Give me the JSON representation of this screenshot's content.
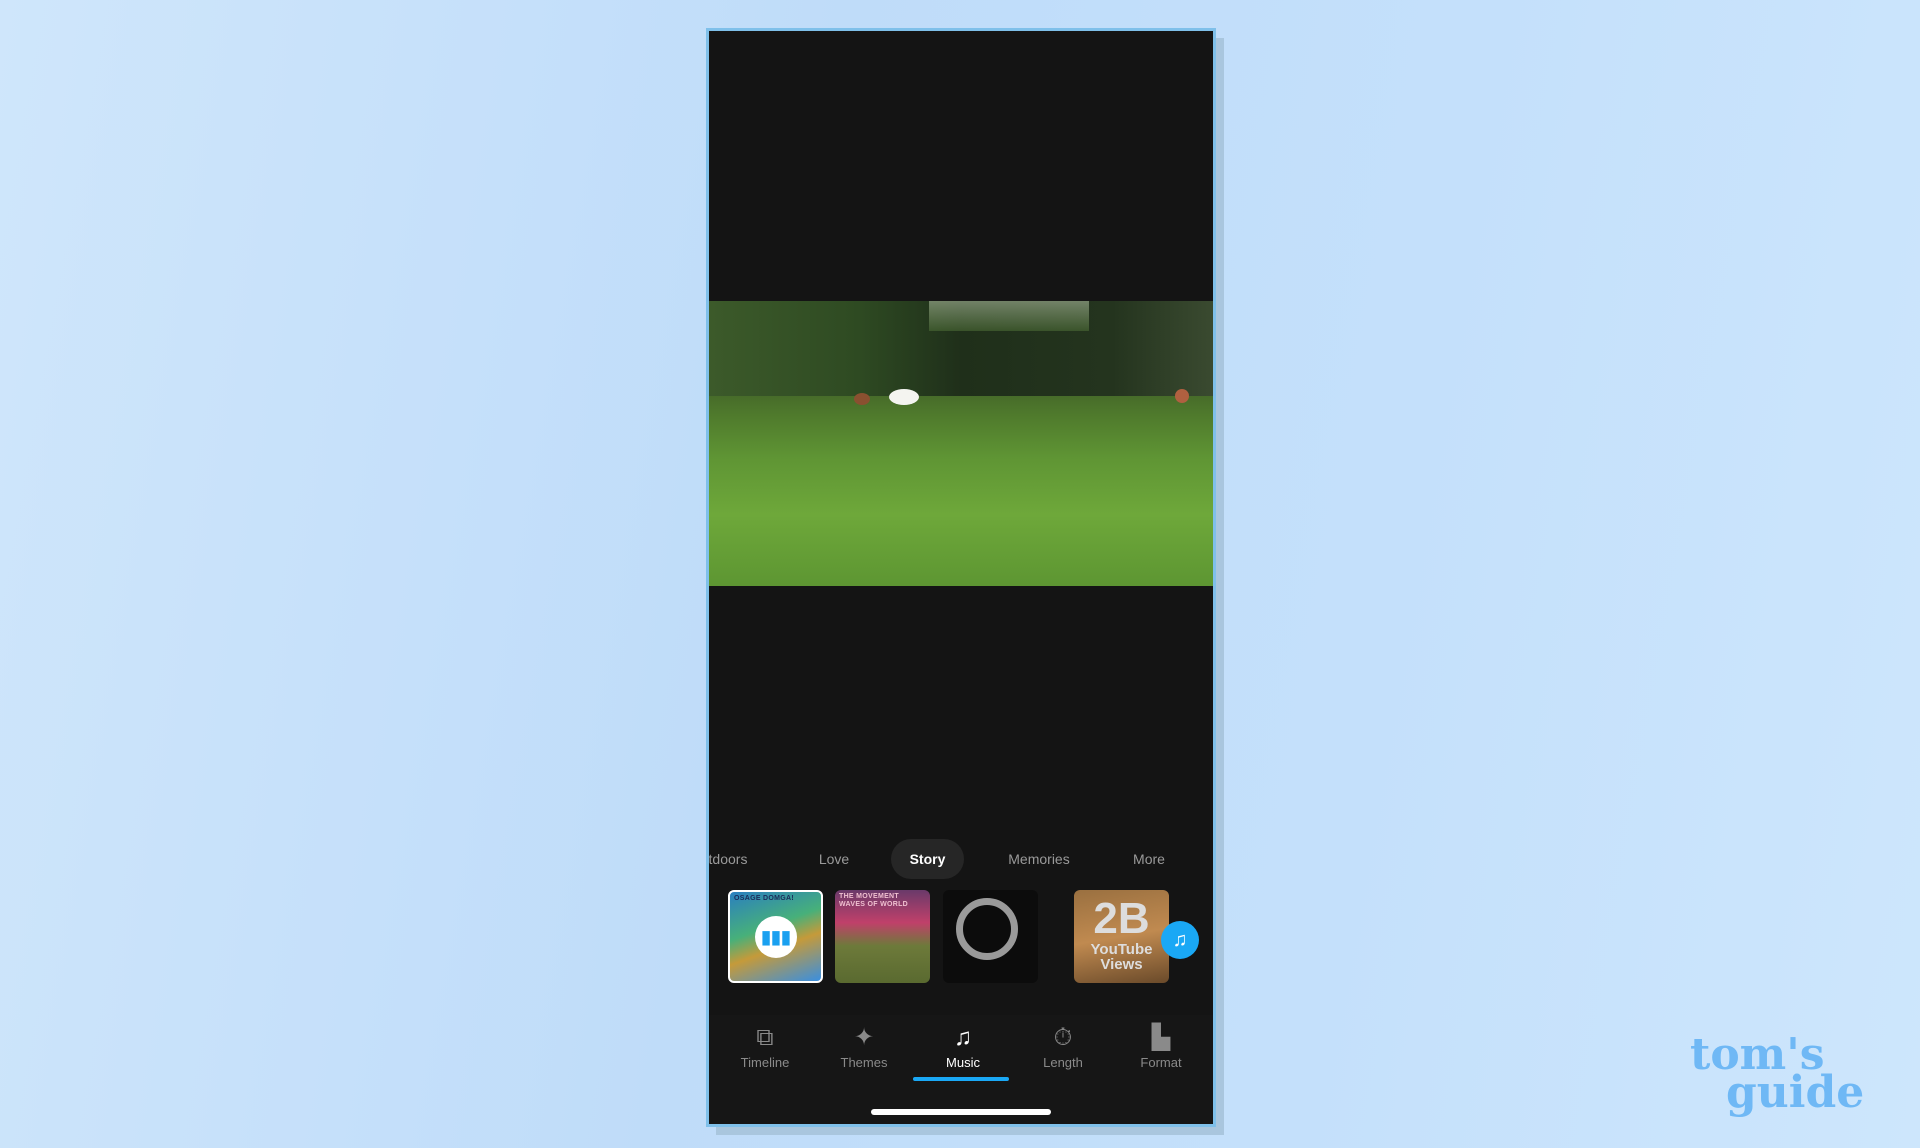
{
  "categories": {
    "items": [
      "tdoors",
      "Love",
      "Story",
      "Memories",
      "More"
    ],
    "active": "Story"
  },
  "music_tracks": [
    {
      "title_art": "OSAGE DOMGA!",
      "playing": true
    },
    {
      "title_art": "THE MOVEMENT WAVES OF WORLD"
    },
    {
      "title_art": ""
    },
    {
      "title_art": "2B YouTube Views"
    }
  ],
  "bottom_nav": {
    "items": [
      {
        "label": "Timeline",
        "icon": "timeline-icon"
      },
      {
        "label": "Themes",
        "icon": "themes-icon"
      },
      {
        "label": "Music",
        "icon": "music-note-icon"
      },
      {
        "label": "Length",
        "icon": "stopwatch-icon"
      },
      {
        "label": "Format",
        "icon": "format-icon"
      }
    ],
    "active": "Music"
  },
  "watermark": {
    "line1": "tom's",
    "line2": "guide"
  },
  "colors": {
    "accent": "#1aa8f5",
    "background": "#141414"
  }
}
